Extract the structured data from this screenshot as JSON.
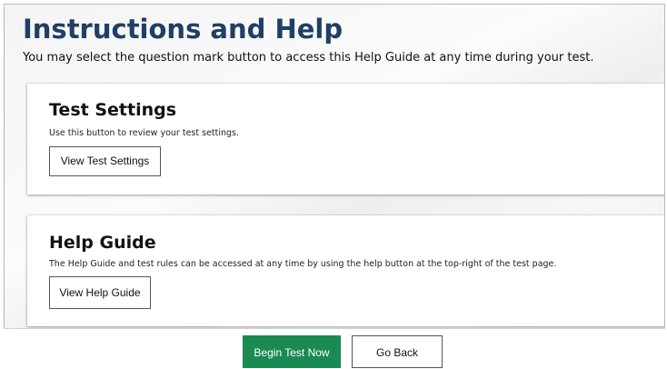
{
  "header": {
    "title": "Instructions and Help",
    "subtitle": "You may select the question mark button to access this Help Guide at any time during your test."
  },
  "sections": {
    "test_settings": {
      "title": "Test Settings",
      "description": "Use this button to review your test settings.",
      "button_label": "View Test Settings"
    },
    "help_guide": {
      "title": "Help Guide",
      "description": "The Help Guide and test rules can be accessed at any time by using the help button at the top-right of the test page.",
      "button_label": "View Help Guide"
    }
  },
  "footer": {
    "begin_label": "Begin Test Now",
    "back_label": "Go Back"
  },
  "colors": {
    "title": "#1f3f66",
    "primary_button": "#1a8a52"
  }
}
